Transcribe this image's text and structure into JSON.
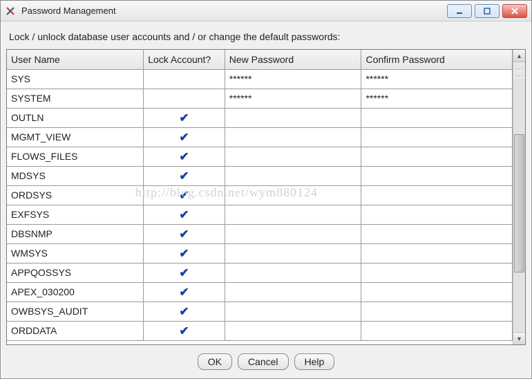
{
  "window": {
    "title": "Password Management"
  },
  "instruction": "Lock / unlock database user accounts and / or change the default passwords:",
  "columns": {
    "user": "User Name",
    "lock": "Lock Account?",
    "newpw": "New Password",
    "confpw": "Confirm Password"
  },
  "rows": [
    {
      "user": "SYS",
      "locked": false,
      "newpw": "******",
      "confpw": "******"
    },
    {
      "user": "SYSTEM",
      "locked": false,
      "newpw": "******",
      "confpw": "******"
    },
    {
      "user": "OUTLN",
      "locked": true,
      "newpw": "",
      "confpw": ""
    },
    {
      "user": "MGMT_VIEW",
      "locked": true,
      "newpw": "",
      "confpw": ""
    },
    {
      "user": "FLOWS_FILES",
      "locked": true,
      "newpw": "",
      "confpw": ""
    },
    {
      "user": "MDSYS",
      "locked": true,
      "newpw": "",
      "confpw": ""
    },
    {
      "user": "ORDSYS",
      "locked": true,
      "newpw": "",
      "confpw": ""
    },
    {
      "user": "EXFSYS",
      "locked": true,
      "newpw": "",
      "confpw": ""
    },
    {
      "user": "DBSNMP",
      "locked": true,
      "newpw": "",
      "confpw": ""
    },
    {
      "user": "WMSYS",
      "locked": true,
      "newpw": "",
      "confpw": ""
    },
    {
      "user": "APPQOSSYS",
      "locked": true,
      "newpw": "",
      "confpw": ""
    },
    {
      "user": "APEX_030200",
      "locked": true,
      "newpw": "",
      "confpw": ""
    },
    {
      "user": "OWBSYS_AUDIT",
      "locked": true,
      "newpw": "",
      "confpw": ""
    },
    {
      "user": "ORDDATA",
      "locked": true,
      "newpw": "",
      "confpw": ""
    }
  ],
  "buttons": {
    "ok": "OK",
    "cancel": "Cancel",
    "help": "Help"
  },
  "watermark": "http://blog.csdn.net/wym880124"
}
